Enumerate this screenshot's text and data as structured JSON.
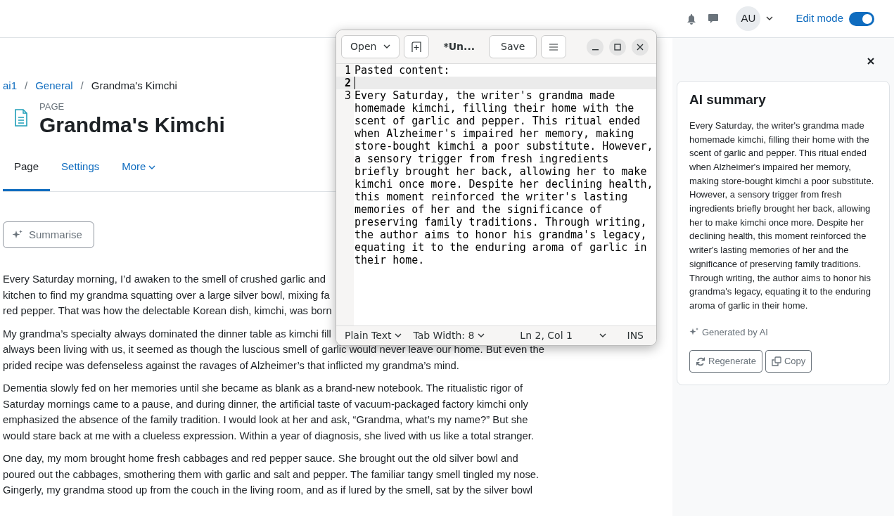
{
  "header": {
    "avatar": "AU",
    "edit_mode": {
      "label": "Edit mode",
      "on": true
    }
  },
  "breadcrumb": [
    {
      "label": "ai1",
      "link": true
    },
    {
      "separator": "/",
      "label": "General",
      "link": true
    },
    {
      "separator": "/",
      "label": "Grandma's Kimchi",
      "link": false
    }
  ],
  "page": {
    "kind_label": "PAGE",
    "title": "Grandma's Kimchi"
  },
  "tabs": [
    {
      "label": "Page",
      "selected": true,
      "dropdown": false
    },
    {
      "label": "Settings",
      "selected": false,
      "dropdown": false
    },
    {
      "label": "More",
      "selected": false,
      "dropdown": true
    }
  ],
  "summarise_button": "Summarise",
  "paragraphs": [
    {
      "lines": [
        "Every Saturday morning, I’d awaken to the smell of crushed garlic and",
        "kitchen to find my grandma squatting over a large silver bowl, mixing fa",
        "red pepper. That was how the delectable Korean dish, kimchi, was born"
      ]
    },
    {
      "lines": [
        "My grandma’s specialty always dominated the dinner table as kimchi fill",
        "always been living with us, it seemed as though the luscious smell of garlic would never leave our home. But even the",
        "prided recipe was defenseless against the ravages of Alzheimer’s that inflicted my grandma’s mind."
      ]
    },
    {
      "lines": [
        "Dementia slowly fed on her memories until she became as blank as a brand-new notebook. The ritualistic rigor of",
        "Saturday mornings came to a pause, and during dinner, the artificial taste of vacuum-packaged factory kimchi only",
        "emphasized the absence of the family tradition. I would look at her and ask, “Grandma, what’s my name?” But she",
        "would stare back at me with a clueless expression. Within a year of diagnosis, she lived with us like a total stranger."
      ]
    },
    {
      "lines": [
        "One day, my mom brought home fresh cabbages and red pepper sauce. She brought out the old silver bowl and",
        "poured out the cabbages, smothering them with garlic and salt and pepper. The familiar tangy smell tingled my nose.",
        "Gingerly, my grandma stood up from the couch in the living room, and as if lured by the smell, sat by the silver bowl"
      ]
    }
  ],
  "editor": {
    "open_button": "Open",
    "title": "*Un...",
    "save_button": "Save",
    "lines": [
      {
        "number": "1",
        "text": "Pasted content:",
        "current": false
      },
      {
        "number": "2",
        "current": true
      },
      {
        "number": "3",
        "text": "Every Saturday, the writer's grandma made homemade kimchi, filling their home with the scent of garlic and pepper. This ritual ended when Alzheimer's impaired her memory, making store-bought kimchi a poor substitute. However, a sensory trigger from fresh ingredients briefly brought her back, allowing her to make kimchi once more. Despite her declining health, this moment reinforced the writer's lasting memories of her and the significance of preserving family traditions. Through writing, the author aims to honor his grandma's legacy, equating it to the enduring aroma of garlic in their home.",
        "current": false
      }
    ],
    "status_bar": {
      "language": "Plain Text",
      "tab_width": "Tab Width: 8",
      "position": "Ln 2, Col 1",
      "mode": "INS"
    }
  },
  "summary": {
    "title": "AI summary",
    "text": "Every Saturday, the writer's grandma made homemade kimchi, filling their home with the scent of garlic and pepper. This ritual ended when Alzheimer's impaired her memory, making store-bought kimchi a poor substitute. However, a sensory trigger from fresh ingredients briefly brought her back, allowing her to make kimchi once more. Despite her declining health, this moment reinforced the writer's lasting memories of her and the significance of preserving family traditions. Through writing, the author aims to honor his grandma's legacy, equating it to the enduring aroma of garlic in their home.",
    "generated_by": "Generated by AI",
    "buttons": [
      {
        "label": "Regenerate",
        "kind": "regenerate"
      },
      {
        "label": "Copy",
        "kind": "copy"
      }
    ]
  }
}
